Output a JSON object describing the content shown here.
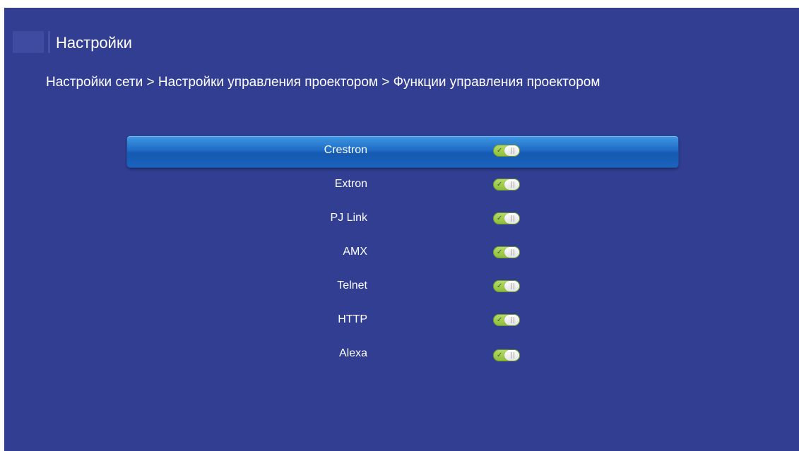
{
  "header": {
    "title": "Настройки",
    "breadcrumb": "Настройки сети > Настройки управления проектором > Функции управления проектором"
  },
  "menu": {
    "selected_index": 0,
    "items": [
      {
        "label": "Crestron",
        "enabled": true
      },
      {
        "label": "Extron",
        "enabled": true
      },
      {
        "label": "PJ Link",
        "enabled": true
      },
      {
        "label": "AMX",
        "enabled": true
      },
      {
        "label": "Telnet",
        "enabled": true
      },
      {
        "label": "HTTP",
        "enabled": true
      },
      {
        "label": "Alexa",
        "enabled": true
      }
    ]
  },
  "icons": {
    "toggle_on": "check-icon",
    "logo": "settings-logo"
  },
  "colors": {
    "background": "#323e92",
    "highlight": "#1e6cc6",
    "toggle_on": "#a6d055",
    "text": "#ffffff"
  }
}
